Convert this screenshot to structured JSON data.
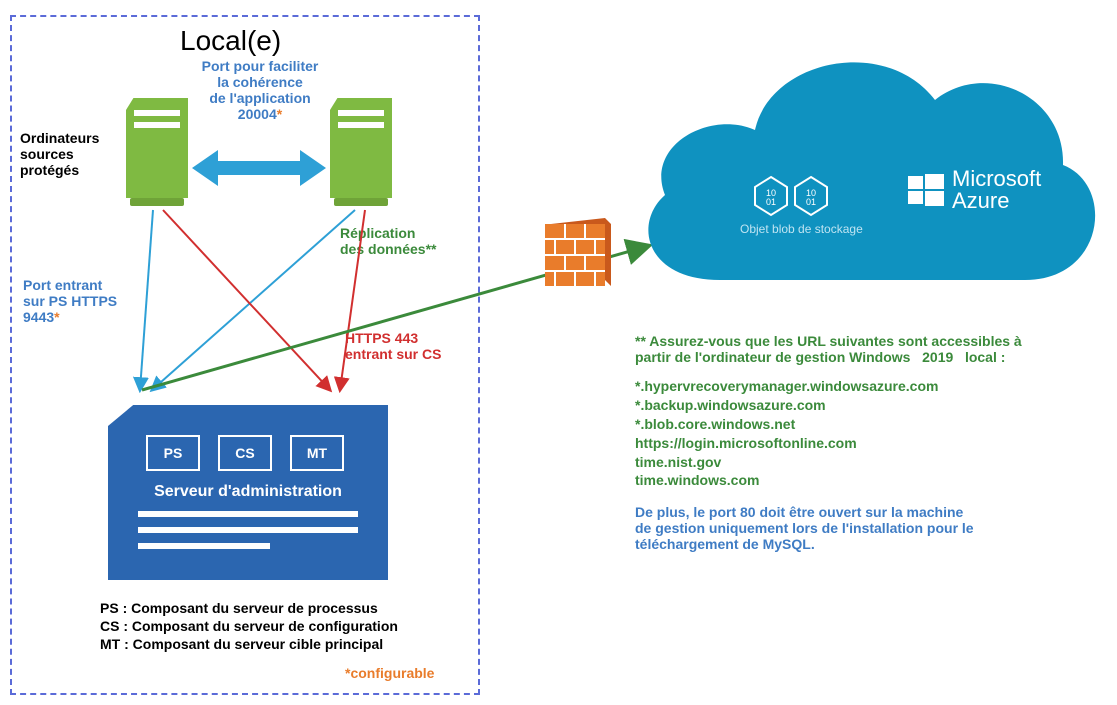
{
  "local": {
    "title": "Local(e)",
    "port_app_line1": "Port pour faciliter",
    "port_app_line2": "la cohérence",
    "port_app_line3": "de l'application",
    "port_app_port": "20004",
    "port_app_ast": "*",
    "src_label_l1": "Ordinateurs",
    "src_label_l2": "sources",
    "src_label_l3": "protégés",
    "port_ps_l1": "Port entrant",
    "port_ps_l2": "sur PS HTTPS",
    "port_ps_port": "9443",
    "port_ps_ast": "*",
    "repl_l1": "Réplication",
    "repl_l2": "des données**",
    "https_l1": "HTTPS 443",
    "https_l2": "entrant sur CS",
    "mgmt": {
      "role_ps": "PS",
      "role_cs": "CS",
      "role_mt": "MT",
      "title": "Serveur d'administration"
    },
    "legend": {
      "ps": "PS : Composant du serveur de processus",
      "cs": "CS : Composant du serveur de configuration",
      "mt": "MT : Composant du serveur cible principal"
    },
    "configurable": "*configurable"
  },
  "cloud": {
    "blob_label": "Objet blob de stockage",
    "brand_top": "Microsoft",
    "brand_bottom": "Azure"
  },
  "notes": {
    "intro1": "** Assurez-vous que les URL suivantes sont accessibles à",
    "intro2a": "partir de l'ordinateur de gestion Windows",
    "intro2_year": "2019",
    "intro2b": "local :",
    "urls": {
      "u1": "*.hypervrecoverymanager.windowsazure.com",
      "u2": "*.backup.windowsazure.com",
      "u3": "*.blob.core.windows.net",
      "u4": "https://login.microsoftonline.com",
      "u5": "time.nist.gov",
      "u6": "time.windows.com"
    },
    "blue1": "De plus, le port 80 doit être ouvert sur la machine",
    "blue2": "de gestion uniquement lors de l'installation pour le",
    "blue3": "téléchargement de MySQL."
  }
}
